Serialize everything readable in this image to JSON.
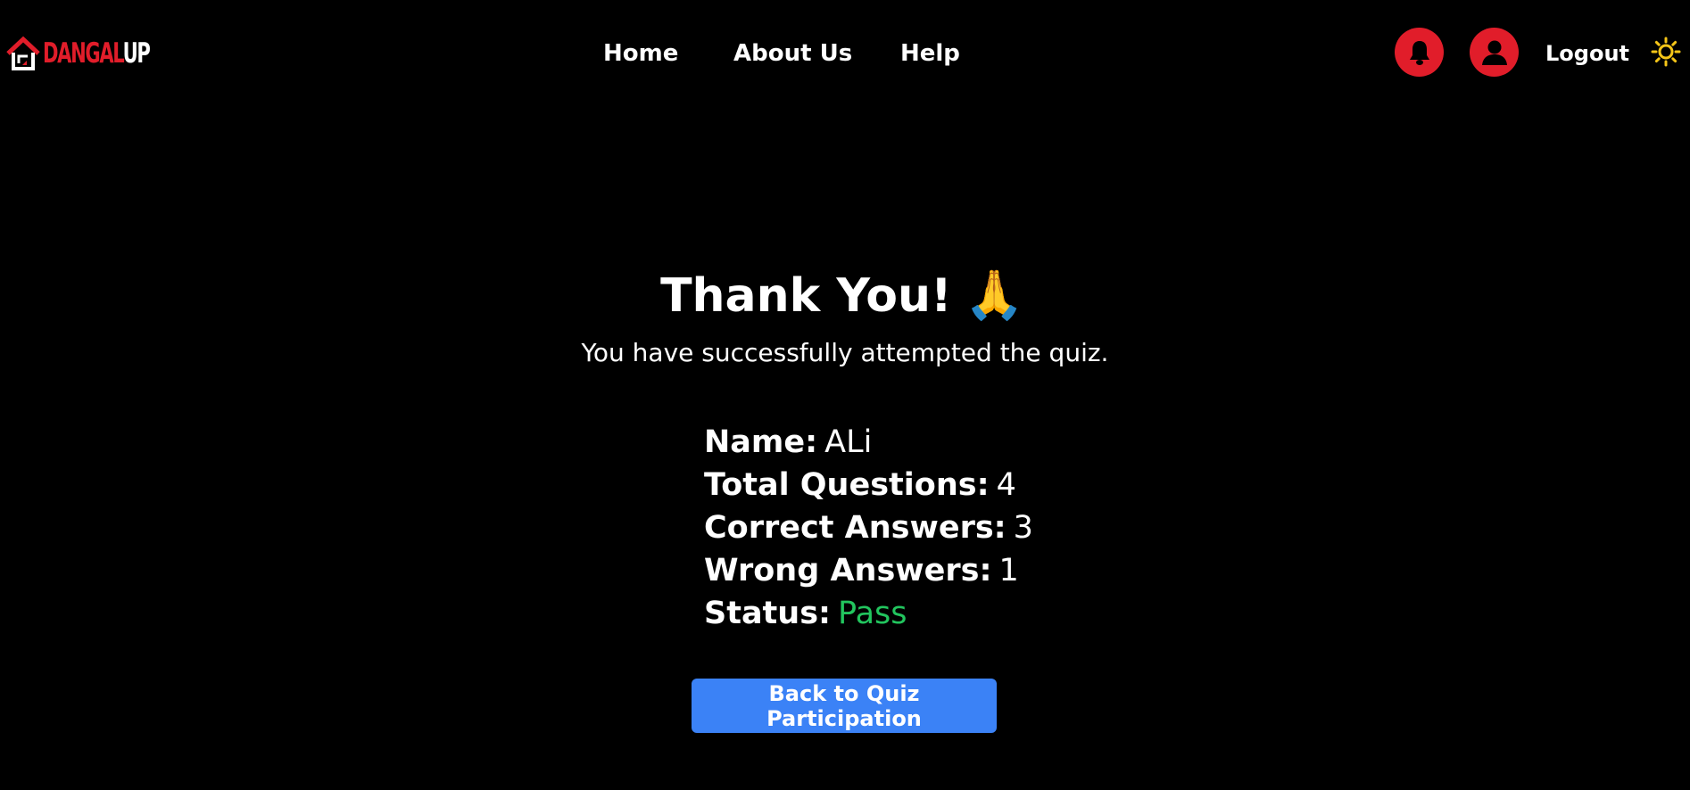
{
  "brand": {
    "logo_part1": "DANGAL",
    "logo_part2": "UP",
    "accent_color": "#e11d2a"
  },
  "nav": {
    "items": [
      {
        "label": "Home"
      },
      {
        "label": "About Us"
      },
      {
        "label": "Help"
      }
    ],
    "logout_label": "Logout",
    "icons": [
      "bell-icon",
      "user-icon",
      "sun-icon"
    ]
  },
  "result": {
    "title": "Thank You!",
    "title_emoji": "🙏",
    "subtitle": "You have successfully attempted the quiz.",
    "fields": [
      {
        "label": "Name:",
        "value": "ALi"
      },
      {
        "label": "Total Questions:",
        "value": "4"
      },
      {
        "label": "Correct Answers:",
        "value": "3"
      },
      {
        "label": "Wrong Answers:",
        "value": "1"
      },
      {
        "label": "Status:",
        "value": "Pass",
        "value_color": "#22c55e"
      }
    ],
    "back_button_label": "Back to Quiz Participation",
    "button_color": "#3b82f6"
  }
}
